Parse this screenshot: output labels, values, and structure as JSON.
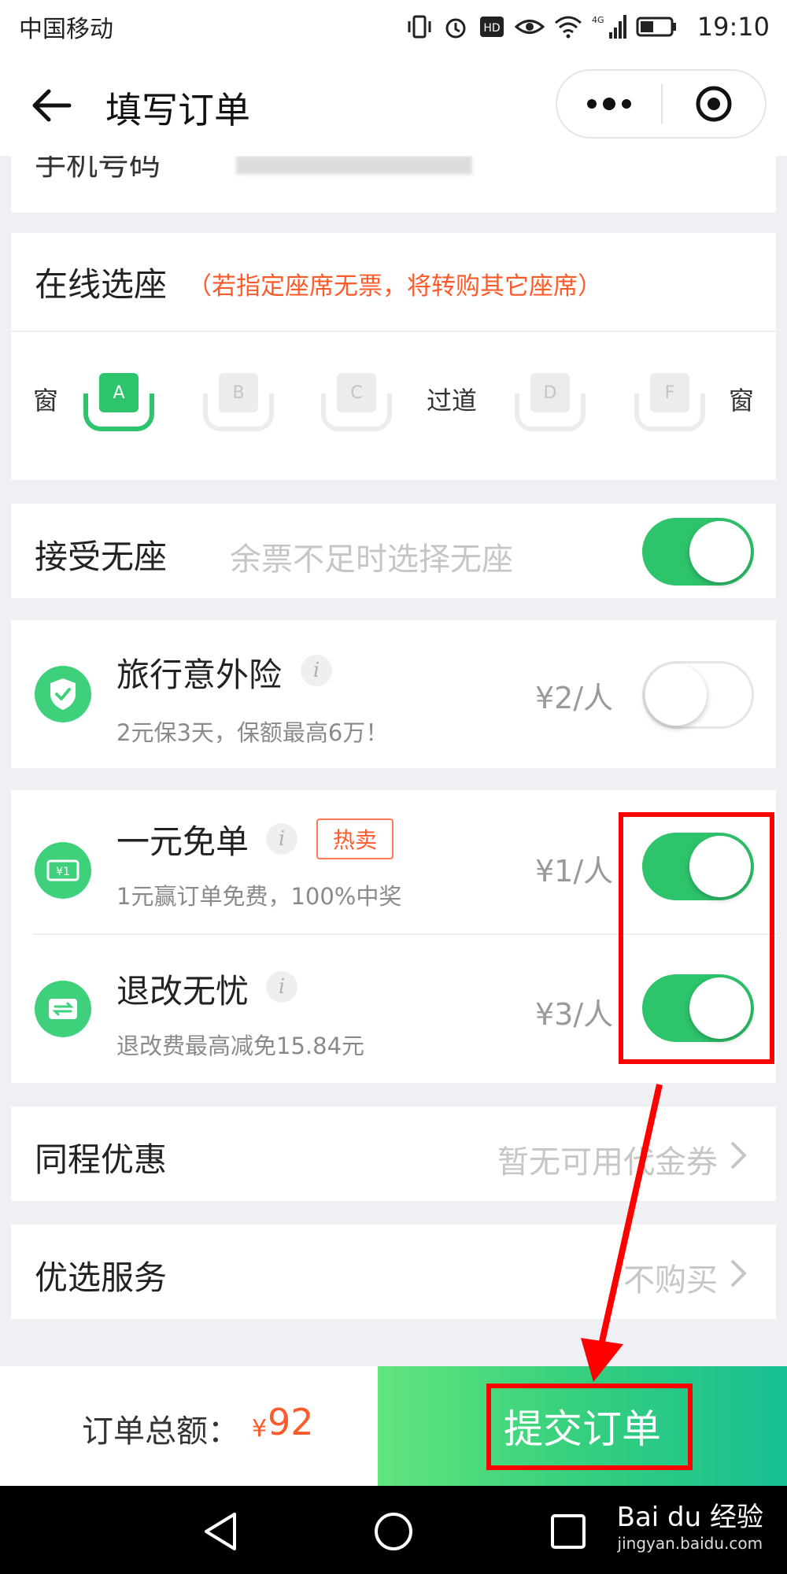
{
  "status_bar": {
    "carrier": "中国移动",
    "network": "4G",
    "time": "19:10"
  },
  "header": {
    "title": "填写订单"
  },
  "phone": {
    "label": "手机号码"
  },
  "seat_selection": {
    "title": "在线选座",
    "note": "（若指定座席无票，将转购其它座席）",
    "left_label": "窗",
    "aisle_label": "过道",
    "right_label": "窗",
    "seats": [
      {
        "letter": "A",
        "selected": true
      },
      {
        "letter": "B",
        "selected": false
      },
      {
        "letter": "C",
        "selected": false
      },
      {
        "letter": "D",
        "selected": false
      },
      {
        "letter": "F",
        "selected": false
      }
    ]
  },
  "no_seat": {
    "title": "接受无座",
    "hint": "余票不足时选择无座",
    "enabled": true
  },
  "insurance": {
    "name": "旅行意外险",
    "desc": "2元保3天，保额最高6万！",
    "price": "¥2/人",
    "enabled": false
  },
  "free_order": {
    "name": "一元免单",
    "badge": "热卖",
    "desc": "1元赢订单免费，100%中奖",
    "price": "¥1/人",
    "enabled": true
  },
  "refund_worry_free": {
    "name": "退改无忧",
    "desc": "退改费最高减免15.84元",
    "price": "¥3/人",
    "enabled": true
  },
  "coupon": {
    "title": "同程优惠",
    "value": "暂无可用代金券"
  },
  "preferred_service": {
    "title": "优选服务",
    "value": "不购买"
  },
  "bottom_bar": {
    "total_label": "订单总额：",
    "currency": "¥",
    "total_amount": "92",
    "submit_label": "提交订单"
  },
  "watermark": {
    "brand": "Bai du 经验",
    "url": "jingyan.baidu.com"
  },
  "colors": {
    "accent_green": "#2ec46b",
    "alert_orange": "#ff5a2a",
    "annotation_red": "#ff0000"
  }
}
